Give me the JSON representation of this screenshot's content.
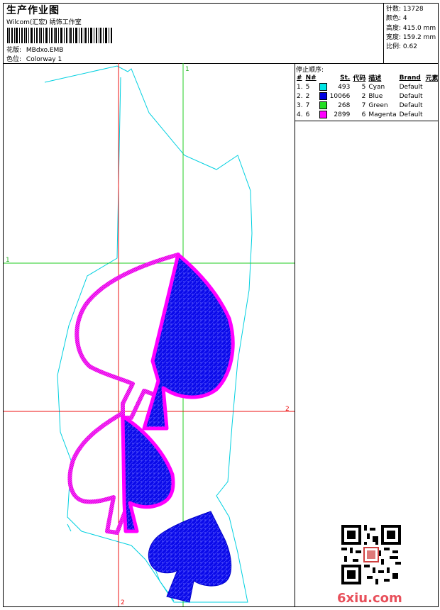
{
  "header": {
    "title": "生产作业图",
    "studio": "Wilcom(汇宏) 绣饰工作室",
    "design_label": "花版:",
    "design_value": "MBdxo.EMB",
    "colorway_label": "色位:",
    "colorway_value": "Colorway 1"
  },
  "stats": [
    {
      "label": "针数:",
      "value": "13728"
    },
    {
      "label": "颜色:",
      "value": "4"
    },
    {
      "label": "高度:",
      "value": "415.0 mm"
    },
    {
      "label": "宽度:",
      "value": "159.2 mm"
    },
    {
      "label": "比例:",
      "value": "0.62"
    }
  ],
  "stop_sequence": {
    "title": "停止顺序:",
    "columns": [
      "#",
      "N#",
      "",
      "St.",
      "代码",
      "描述",
      "Brand",
      "元素"
    ],
    "rows": [
      {
        "idx": "1.",
        "n": "5",
        "color": "#00e5e5",
        "st": "493",
        "code": "5",
        "desc": "Cyan",
        "brand": "Default"
      },
      {
        "idx": "2.",
        "n": "2",
        "color": "#0000e0",
        "st": "10066",
        "code": "2",
        "desc": "Blue",
        "brand": "Default"
      },
      {
        "idx": "3.",
        "n": "7",
        "color": "#22dd22",
        "st": "268",
        "code": "7",
        "desc": "Green",
        "brand": "Default"
      },
      {
        "idx": "4.",
        "n": "6",
        "color": "#ff00ff",
        "st": "2899",
        "code": "6",
        "desc": "Magenta",
        "brand": "Default"
      }
    ]
  },
  "guides": {
    "green_v": "1",
    "green_h": "1",
    "red_h": "2",
    "red_v": "2"
  },
  "watermark": "6xiu.com"
}
